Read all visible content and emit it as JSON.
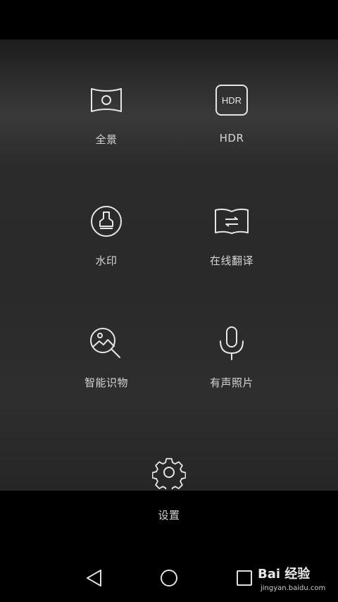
{
  "modes": [
    {
      "id": "panorama",
      "label": "全景",
      "icon": "panorama-icon"
    },
    {
      "id": "hdr",
      "label": "HDR",
      "icon": "hdr-icon",
      "icon_text": "HDR"
    },
    {
      "id": "watermark",
      "label": "水印",
      "icon": "stamp-icon"
    },
    {
      "id": "translate",
      "label": "在线翻译",
      "icon": "book-translate-icon"
    },
    {
      "id": "identify",
      "label": "智能识物",
      "icon": "image-search-icon"
    },
    {
      "id": "audio_photo",
      "label": "有声照片",
      "icon": "microphone-icon"
    }
  ],
  "settings": {
    "label": "设置",
    "icon": "gear-icon"
  },
  "nav": {
    "back": "back-triangle-icon",
    "home": "home-circle-icon",
    "recent": "recent-square-icon"
  },
  "watermark": {
    "main": "Bai 经验",
    "sub": "jingyan.baidu.com"
  },
  "colors": {
    "panel_bg": "#2b2b2b",
    "bars": "#000000",
    "icon_stroke": "#e6e6e6",
    "label": "#d6d6d6"
  }
}
